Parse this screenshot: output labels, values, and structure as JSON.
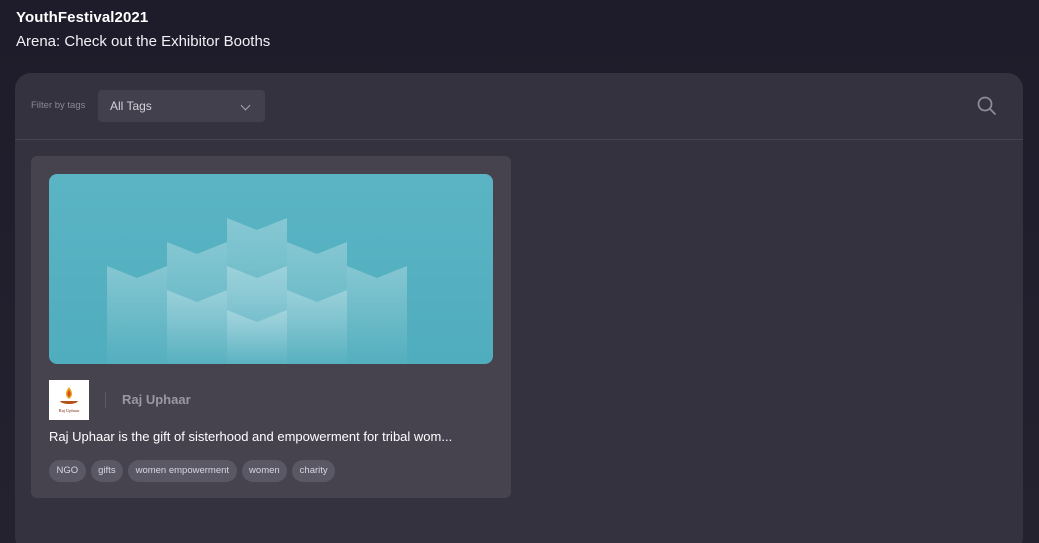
{
  "header": {
    "event_title": "YouthFestival2021",
    "subtitle": "Arena: Check out the Exhibitor Booths"
  },
  "toolbar": {
    "filter_label": "Filter by tags",
    "tag_select": {
      "value": "All Tags",
      "icon": "chevron-down-icon"
    },
    "search_icon": "search-icon"
  },
  "booths": [
    {
      "name": "Raj Uphaar",
      "logo_text": "Raj Uphaar",
      "description": "Raj Uphaar is the gift of sisterhood and empowerment for tribal wom...",
      "tags": [
        "NGO",
        "gifts",
        "women empowerment",
        "women",
        "charity"
      ]
    }
  ],
  "colors": {
    "page_bg": "#1e1c2a",
    "panel_bg": "#34323f",
    "card_bg": "#46434f",
    "banner": "#55b1c1",
    "tag_bg": "#5b5866"
  }
}
